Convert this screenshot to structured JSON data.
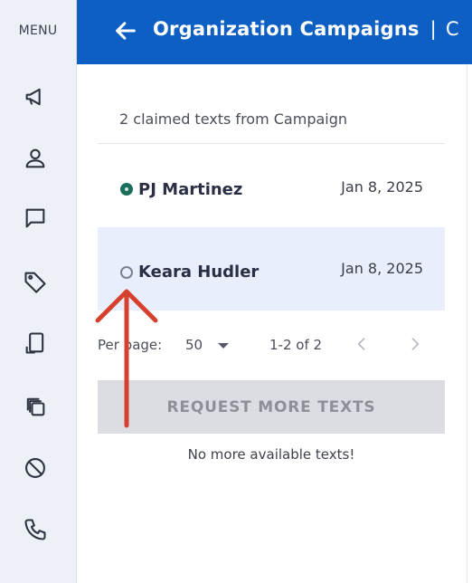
{
  "sidebar": {
    "menu_label": "MENU",
    "icons": [
      "megaphone-icon",
      "person-icon",
      "chat-bubble-icon",
      "tag-icon",
      "phone-tablet-icon",
      "copy-icon",
      "block-icon",
      "phone-icon"
    ]
  },
  "header": {
    "title": "Organization Campaigns",
    "separator": "|",
    "extra": "C",
    "background": "#0d5fc3"
  },
  "panel": {
    "summary": "2 claimed texts from Campaign",
    "rows": [
      {
        "name": "PJ Martinez",
        "date": "Jan 8, 2025",
        "status": "active"
      },
      {
        "name": "Keara Hudler",
        "date": "Jan 8, 2025",
        "status": "inactive"
      }
    ],
    "pager": {
      "label": "Per page:",
      "per_page": "50",
      "range": "1-2 of 2"
    },
    "request_button": "REQUEST MORE TEXTS",
    "no_more": "No more available texts!"
  },
  "annotation": {
    "color": "#d6402f"
  }
}
